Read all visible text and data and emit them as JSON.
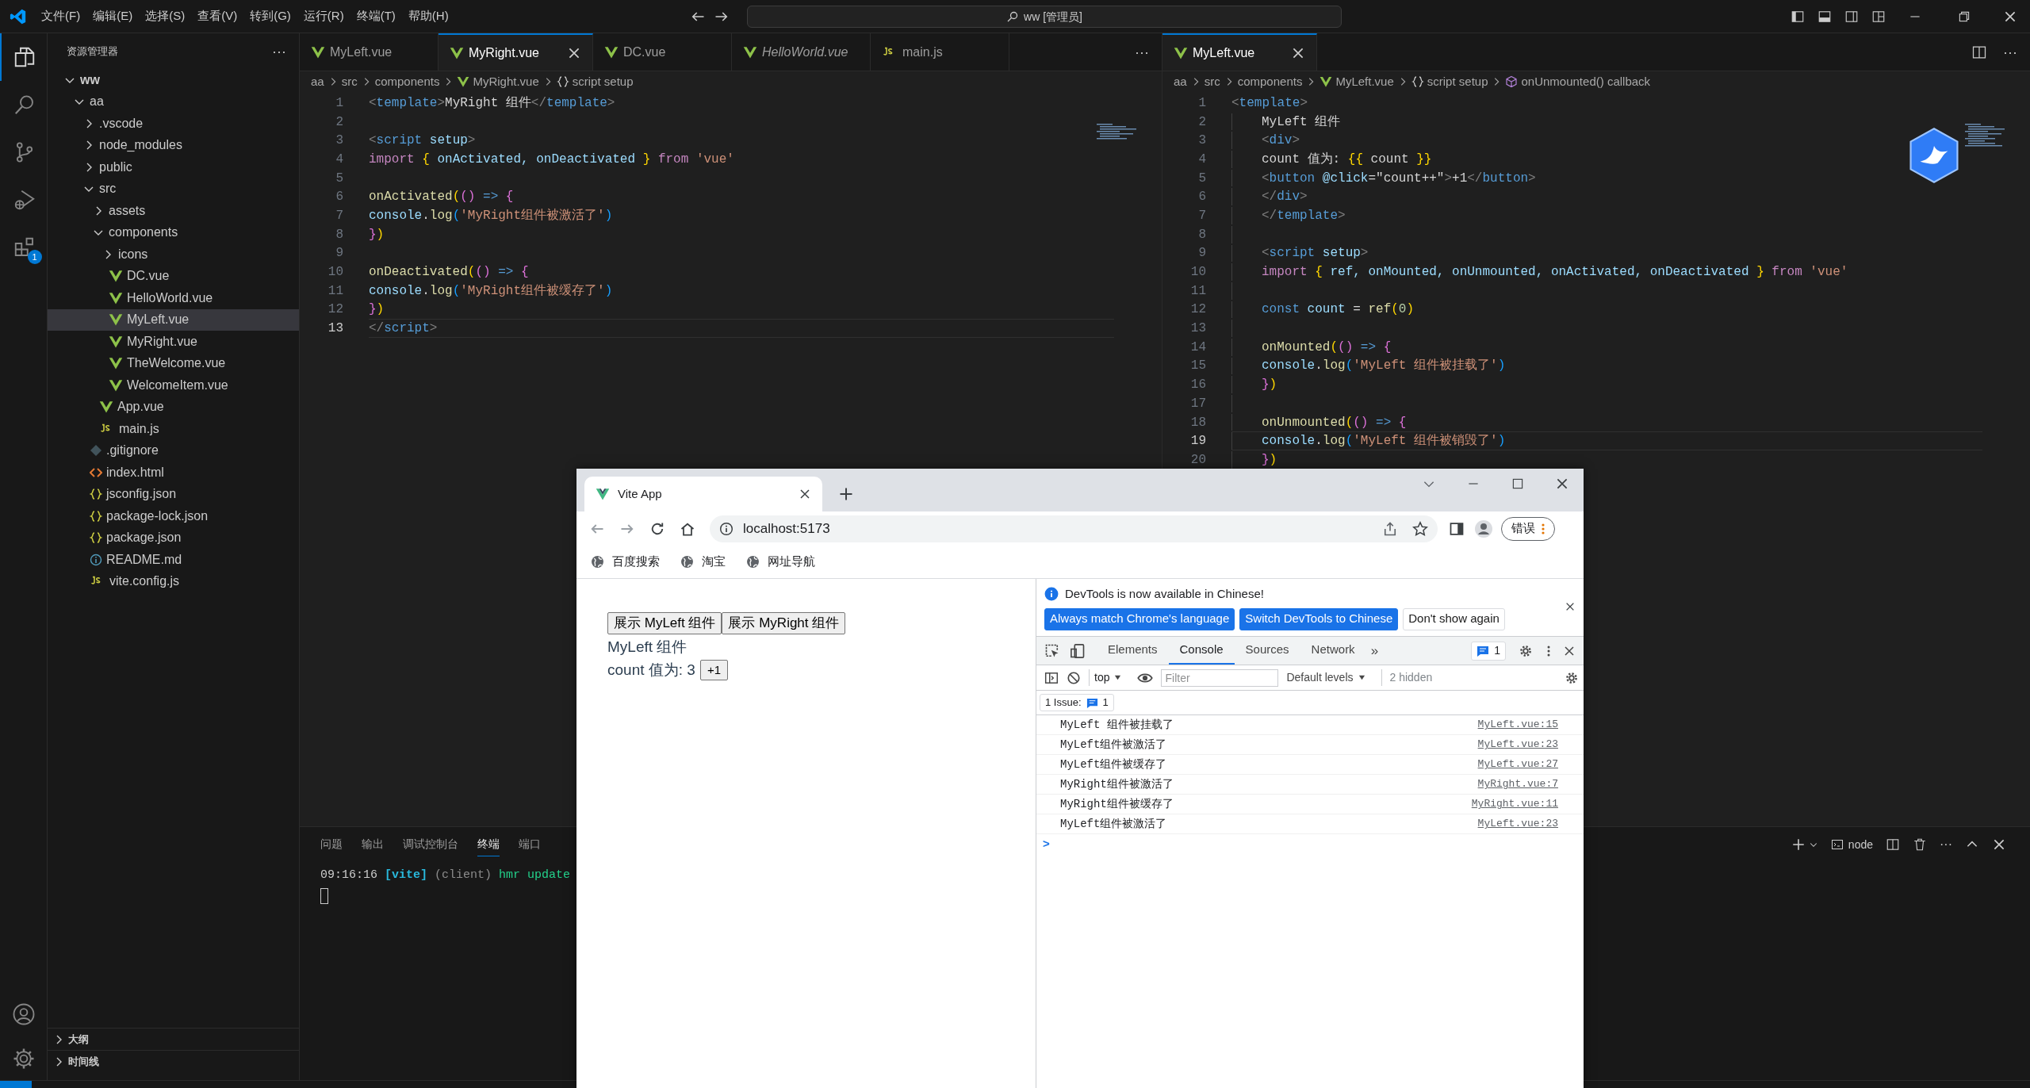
{
  "titlebar": {
    "menus": [
      "文件(F)",
      "编辑(E)",
      "选择(S)",
      "查看(V)",
      "转到(G)",
      "运行(R)",
      "终端(T)",
      "帮助(H)"
    ],
    "search": "ww [管理员]"
  },
  "activity_bar": [
    {
      "kind": "files",
      "selected": true
    },
    {
      "kind": "search",
      "selected": false
    },
    {
      "kind": "source-control",
      "selected": false
    },
    {
      "kind": "run",
      "selected": false
    },
    {
      "kind": "extensions",
      "selected": false,
      "badge": "1"
    }
  ],
  "sidebar": {
    "title": "资源管理器",
    "more": "···",
    "tree": [
      {
        "label": "ww",
        "kind": "root",
        "expanded": true,
        "selected": false,
        "children": [
          {
            "label": "aa",
            "expanded": true,
            "selected": false,
            "children": [
              {
                "label": ".vscode",
                "expanded": false,
                "selected": false
              },
              {
                "label": "node_modules",
                "expanded": false,
                "selected": false
              },
              {
                "label": "public",
                "expanded": false,
                "selected": false
              },
              {
                "label": "src",
                "expanded": true,
                "selected": false,
                "children": [
                  {
                    "label": "assets",
                    "expanded": false,
                    "selected": false
                  },
                  {
                    "label": "components",
                    "expanded": true,
                    "selected": false,
                    "children": [
                      {
                        "label": "icons",
                        "expanded": false,
                        "selected": false
                      },
                      {
                        "label": "DC.vue",
                        "kind": "vue",
                        "selected": false
                      },
                      {
                        "label": "HelloWorld.vue",
                        "kind": "vue",
                        "selected": false
                      },
                      {
                        "label": "MyLeft.vue",
                        "kind": "vue",
                        "selected": true
                      },
                      {
                        "label": "MyRight.vue",
                        "kind": "vue",
                        "selected": false
                      },
                      {
                        "label": "TheWelcome.vue",
                        "kind": "vue",
                        "selected": false
                      },
                      {
                        "label": "WelcomeItem.vue",
                        "kind": "vue",
                        "selected": false
                      }
                    ]
                  },
                  {
                    "label": "App.vue",
                    "kind": "vue",
                    "selected": false
                  },
                  {
                    "label": "main.js",
                    "kind": "js",
                    "selected": false
                  }
                ]
              },
              {
                "label": ".gitignore",
                "kind": "git",
                "selected": false
              },
              {
                "label": "index.html",
                "kind": "html",
                "selected": false
              },
              {
                "label": "jsconfig.json",
                "kind": "json",
                "selected": false
              },
              {
                "label": "package-lock.json",
                "kind": "json",
                "selected": false
              },
              {
                "label": "package.json",
                "kind": "json",
                "selected": false
              },
              {
                "label": "README.md",
                "kind": "info",
                "selected": false
              },
              {
                "label": "vite.config.js",
                "kind": "js",
                "selected": false
              }
            ]
          }
        ]
      }
    ],
    "sections": [
      {
        "label": "大纲",
        "expanded": false
      },
      {
        "label": "时间线",
        "expanded": false
      }
    ]
  },
  "editor_groups": [
    {
      "tabs": [
        {
          "label": "MyLeft.vue",
          "kind": "vue",
          "selected": false,
          "preview": false
        },
        {
          "label": "MyRight.vue",
          "kind": "vue",
          "selected": true,
          "preview": false
        },
        {
          "label": "DC.vue",
          "kind": "vue",
          "selected": false,
          "preview": false
        },
        {
          "label": "HelloWorld.vue",
          "kind": "vue",
          "selected": false,
          "preview": true
        },
        {
          "label": "main.js",
          "kind": "js",
          "selected": false,
          "preview": false
        }
      ],
      "more": "···",
      "breadcrumb": [
        {
          "label": "aa"
        },
        {
          "label": "src"
        },
        {
          "label": "components"
        },
        {
          "label": "MyRight.vue",
          "kind": "vue"
        },
        {
          "label": "script setup",
          "kind": "braces"
        }
      ],
      "lines": [
        {
          "number": "1",
          "current": false,
          "indented": false,
          "tokens": [
            {
              "kind": "punct",
              "text": "<"
            },
            {
              "kind": "tag",
              "text": "template"
            },
            {
              "kind": "punct",
              "text": ">"
            },
            {
              "kind": "text",
              "text": "MyRight 组件"
            },
            {
              "kind": "punct",
              "text": "</"
            },
            {
              "kind": "tag",
              "text": "template"
            },
            {
              "kind": "punct",
              "text": ">"
            }
          ]
        },
        {
          "number": "2",
          "current": false,
          "indented": false
        },
        {
          "number": "3",
          "current": false,
          "indented": false,
          "tokens": [
            {
              "kind": "punct",
              "text": "<"
            },
            {
              "kind": "tag",
              "text": "script"
            },
            {
              "kind": "attr",
              "text": " setup"
            },
            {
              "kind": "punct",
              "text": ">"
            }
          ]
        },
        {
          "number": "4",
          "current": false,
          "indented": false,
          "tokens": [
            {
              "kind": "keyword",
              "text": "import "
            },
            {
              "kind": "b1",
              "text": "{"
            },
            {
              "kind": "var",
              "text": " onActivated, onDeactivated "
            },
            {
              "kind": "b1",
              "text": "}"
            },
            {
              "kind": "keyword",
              "text": " from "
            },
            {
              "kind": "string",
              "text": "'vue'"
            }
          ]
        },
        {
          "number": "5",
          "current": false,
          "indented": false
        },
        {
          "number": "6",
          "current": false,
          "indented": false,
          "tokens": [
            {
              "kind": "func",
              "text": "onActivated"
            },
            {
              "kind": "b1",
              "text": "("
            },
            {
              "kind": "b2",
              "text": "()"
            },
            {
              "kind": "storage",
              "text": " => "
            },
            {
              "kind": "b2",
              "text": "{"
            }
          ]
        },
        {
          "number": "7",
          "current": false,
          "indented": false,
          "tokens": [
            {
              "kind": "var",
              "text": "console"
            },
            {
              "kind": "text",
              "text": "."
            },
            {
              "kind": "func",
              "text": "log"
            },
            {
              "kind": "b3",
              "text": "("
            },
            {
              "kind": "string",
              "text": "'MyRight组件被激活了'"
            },
            {
              "kind": "b3",
              "text": ")"
            }
          ]
        },
        {
          "number": "8",
          "current": false,
          "indented": false,
          "tokens": [
            {
              "kind": "b2",
              "text": "}"
            },
            {
              "kind": "b1",
              "text": ")"
            }
          ]
        },
        {
          "number": "9",
          "current": false,
          "indented": false
        },
        {
          "number": "10",
          "current": false,
          "indented": false,
          "tokens": [
            {
              "kind": "func",
              "text": "onDeactivated"
            },
            {
              "kind": "b1",
              "text": "("
            },
            {
              "kind": "b2",
              "text": "()"
            },
            {
              "kind": "storage",
              "text": " => "
            },
            {
              "kind": "b2",
              "text": "{"
            }
          ]
        },
        {
          "number": "11",
          "current": false,
          "indented": false,
          "tokens": [
            {
              "kind": "var",
              "text": "console"
            },
            {
              "kind": "text",
              "text": "."
            },
            {
              "kind": "func",
              "text": "log"
            },
            {
              "kind": "b3",
              "text": "("
            },
            {
              "kind": "string",
              "text": "'MyRight组件被缓存了'"
            },
            {
              "kind": "b3",
              "text": ")"
            }
          ]
        },
        {
          "number": "12",
          "current": false,
          "indented": false,
          "tokens": [
            {
              "kind": "b2",
              "text": "}"
            },
            {
              "kind": "b1",
              "text": ")"
            }
          ]
        },
        {
          "number": "13",
          "current": true,
          "indented": false,
          "tokens": [
            {
              "kind": "punct",
              "text": "</"
            },
            {
              "kind": "tag",
              "text": "script"
            },
            {
              "kind": "punct",
              "text": ">"
            }
          ]
        }
      ]
    },
    {
      "tabs": [
        {
          "label": "MyLeft.vue",
          "kind": "vue",
          "selected": true,
          "preview": false
        }
      ],
      "more": "···",
      "breadcrumb": [
        {
          "label": "aa"
        },
        {
          "label": "src"
        },
        {
          "label": "components"
        },
        {
          "label": "MyLeft.vue",
          "kind": "vue"
        },
        {
          "label": "script setup",
          "kind": "braces"
        },
        {
          "label": "onUnmounted() callback",
          "kind": "method"
        }
      ],
      "lines": [
        {
          "number": "1",
          "current": false,
          "indented": false,
          "tokens": [
            {
              "kind": "punct",
              "text": "<"
            },
            {
              "kind": "tag",
              "text": "template"
            },
            {
              "kind": "punct",
              "text": ">"
            }
          ]
        },
        {
          "number": "2",
          "current": false,
          "indented": true,
          "tokens": [
            {
              "kind": "text",
              "text": "MyLeft 组件"
            }
          ]
        },
        {
          "number": "3",
          "current": false,
          "indented": true,
          "tokens": [
            {
              "kind": "punct",
              "text": "<"
            },
            {
              "kind": "tag",
              "text": "div"
            },
            {
              "kind": "punct",
              "text": ">"
            }
          ]
        },
        {
          "number": "4",
          "current": false,
          "indented": true,
          "tokens": [
            {
              "kind": "text",
              "text": "count 值为: "
            },
            {
              "kind": "b1",
              "text": "{{"
            },
            {
              "kind": "text",
              "text": " count "
            },
            {
              "kind": "b1",
              "text": "}}"
            }
          ]
        },
        {
          "number": "5",
          "current": false,
          "indented": true,
          "tokens": [
            {
              "kind": "punct",
              "text": "<"
            },
            {
              "kind": "tag",
              "text": "button"
            },
            {
              "kind": "attr",
              "text": " @click"
            },
            {
              "kind": "text",
              "text": "=\"count++\""
            },
            {
              "kind": "punct",
              "text": ">"
            },
            {
              "kind": "text",
              "text": "+1"
            },
            {
              "kind": "punct",
              "text": "</"
            },
            {
              "kind": "tag",
              "text": "button"
            },
            {
              "kind": "punct",
              "text": ">"
            }
          ]
        },
        {
          "number": "6",
          "current": false,
          "indented": true,
          "tokens": [
            {
              "kind": "punct",
              "text": "</"
            },
            {
              "kind": "tag",
              "text": "div"
            },
            {
              "kind": "punct",
              "text": ">"
            }
          ]
        },
        {
          "number": "7",
          "current": false,
          "indented": true,
          "tokens": [
            {
              "kind": "punct",
              "text": "</"
            },
            {
              "kind": "tag",
              "text": "template"
            },
            {
              "kind": "punct",
              "text": ">"
            }
          ]
        },
        {
          "number": "8",
          "current": false,
          "indented": true
        },
        {
          "number": "9",
          "current": false,
          "indented": true,
          "tokens": [
            {
              "kind": "punct",
              "text": "<"
            },
            {
              "kind": "tag",
              "text": "script"
            },
            {
              "kind": "attr",
              "text": " setup"
            },
            {
              "kind": "punct",
              "text": ">"
            }
          ]
        },
        {
          "number": "10",
          "current": false,
          "indented": true,
          "tokens": [
            {
              "kind": "keyword",
              "text": "import "
            },
            {
              "kind": "b1",
              "text": "{"
            },
            {
              "kind": "var",
              "text": " ref, onMounted, onUnmounted, onActivated, onDeactivated "
            },
            {
              "kind": "b1",
              "text": "}"
            },
            {
              "kind": "keyword",
              "text": " from "
            },
            {
              "kind": "string",
              "text": "'vue'"
            }
          ]
        },
        {
          "number": "11",
          "current": false,
          "indented": true
        },
        {
          "number": "12",
          "current": false,
          "indented": true,
          "tokens": [
            {
              "kind": "storage",
              "text": "const"
            },
            {
              "kind": "var",
              "text": " count"
            },
            {
              "kind": "text",
              "text": " = "
            },
            {
              "kind": "func",
              "text": "ref"
            },
            {
              "kind": "b1",
              "text": "("
            },
            {
              "kind": "num",
              "text": "0"
            },
            {
              "kind": "b1",
              "text": ")"
            }
          ]
        },
        {
          "number": "13",
          "current": false,
          "indented": true
        },
        {
          "number": "14",
          "current": false,
          "indented": true,
          "tokens": [
            {
              "kind": "func",
              "text": "onMounted"
            },
            {
              "kind": "b1",
              "text": "("
            },
            {
              "kind": "b2",
              "text": "()"
            },
            {
              "kind": "storage",
              "text": " => "
            },
            {
              "kind": "b2",
              "text": "{"
            }
          ]
        },
        {
          "number": "15",
          "current": false,
          "indented": true,
          "tokens": [
            {
              "kind": "var",
              "text": "console"
            },
            {
              "kind": "text",
              "text": "."
            },
            {
              "kind": "func",
              "text": "log"
            },
            {
              "kind": "b3",
              "text": "("
            },
            {
              "kind": "string",
              "text": "'MyLeft 组件被挂载了'"
            },
            {
              "kind": "b3",
              "text": ")"
            }
          ]
        },
        {
          "number": "16",
          "current": false,
          "indented": true,
          "tokens": [
            {
              "kind": "b2",
              "text": "}"
            },
            {
              "kind": "b1",
              "text": ")"
            }
          ]
        },
        {
          "number": "17",
          "current": false,
          "indented": true
        },
        {
          "number": "18",
          "current": false,
          "indented": true,
          "tokens": [
            {
              "kind": "func",
              "text": "onUnmounted"
            },
            {
              "kind": "b1",
              "text": "("
            },
            {
              "kind": "b2",
              "text": "()"
            },
            {
              "kind": "storage",
              "text": " => "
            },
            {
              "kind": "b2",
              "text": "{"
            }
          ]
        },
        {
          "number": "19",
          "current": true,
          "indented": true,
          "tokens": [
            {
              "kind": "var",
              "text": "console"
            },
            {
              "kind": "text",
              "text": "."
            },
            {
              "kind": "func",
              "text": "log"
            },
            {
              "kind": "b3",
              "text": "("
            },
            {
              "kind": "string",
              "text": "'MyLeft 组件被销毁了'"
            },
            {
              "kind": "b3",
              "text": ")"
            }
          ]
        },
        {
          "number": "20",
          "current": false,
          "indented": true,
          "tokens": [
            {
              "kind": "b2",
              "text": "}"
            },
            {
              "kind": "b1",
              "text": ")"
            }
          ]
        }
      ]
    }
  ],
  "panel": {
    "tabs": [
      {
        "label": "问题",
        "selected": false
      },
      {
        "label": "输出",
        "selected": false
      },
      {
        "label": "调试控制台",
        "selected": false
      },
      {
        "label": "终端",
        "selected": true
      },
      {
        "label": "端口",
        "selected": false
      }
    ],
    "terminal_name": "node",
    "more": "···",
    "terminal_line": [
      {
        "kind": "time",
        "text": "09:16:16"
      },
      {
        "kind": "tag",
        "text": "[vite]"
      },
      {
        "kind": "dim",
        "text": "(client)"
      },
      {
        "kind": "ok",
        "text": "hmr update"
      }
    ]
  },
  "browser": {
    "tab_title": "Vite App",
    "url": "localhost:5173",
    "profile_button": "错误",
    "bookmarks": [
      "百度搜索",
      "淘宝",
      "网址导航"
    ],
    "page": {
      "buttons": [
        "展示 MyLeft 组件",
        "展示 MyRight 组件"
      ],
      "heading": "MyLeft 组件",
      "count_label": "count 值为: 3",
      "increment": "+1"
    },
    "devtools": {
      "notice": "DevTools is now available in Chinese!",
      "notice_buttons": [
        {
          "label": "Always match Chrome's language",
          "kind": "primary"
        },
        {
          "label": "Switch DevTools to Chinese",
          "kind": "primary"
        },
        {
          "label": "Don't show again",
          "kind": "secondary"
        }
      ],
      "tabs": [
        {
          "label": "Elements",
          "selected": false
        },
        {
          "label": "Console",
          "selected": true
        },
        {
          "label": "Sources",
          "selected": false
        },
        {
          "label": "Network",
          "selected": false
        }
      ],
      "more": "»",
      "issues_badge": "1",
      "context": "top",
      "filter_placeholder": "Filter",
      "levels": "Default levels",
      "hidden": "2 hidden",
      "issues_label": "1 Issue:",
      "issues_count": "1",
      "logs": [
        {
          "message": "MyLeft 组件被挂载了",
          "source": "MyLeft.vue:15"
        },
        {
          "message": "MyLeft组件被激活了",
          "source": "MyLeft.vue:23"
        },
        {
          "message": "MyLeft组件被缓存了",
          "source": "MyLeft.vue:27"
        },
        {
          "message": "MyRight组件被激活了",
          "source": "MyRight.vue:7"
        },
        {
          "message": "MyRight组件被缓存了",
          "source": "MyRight.vue:11"
        },
        {
          "message": "MyLeft组件被激活了",
          "source": "MyLeft.vue:23"
        }
      ],
      "prompt": ">"
    }
  }
}
